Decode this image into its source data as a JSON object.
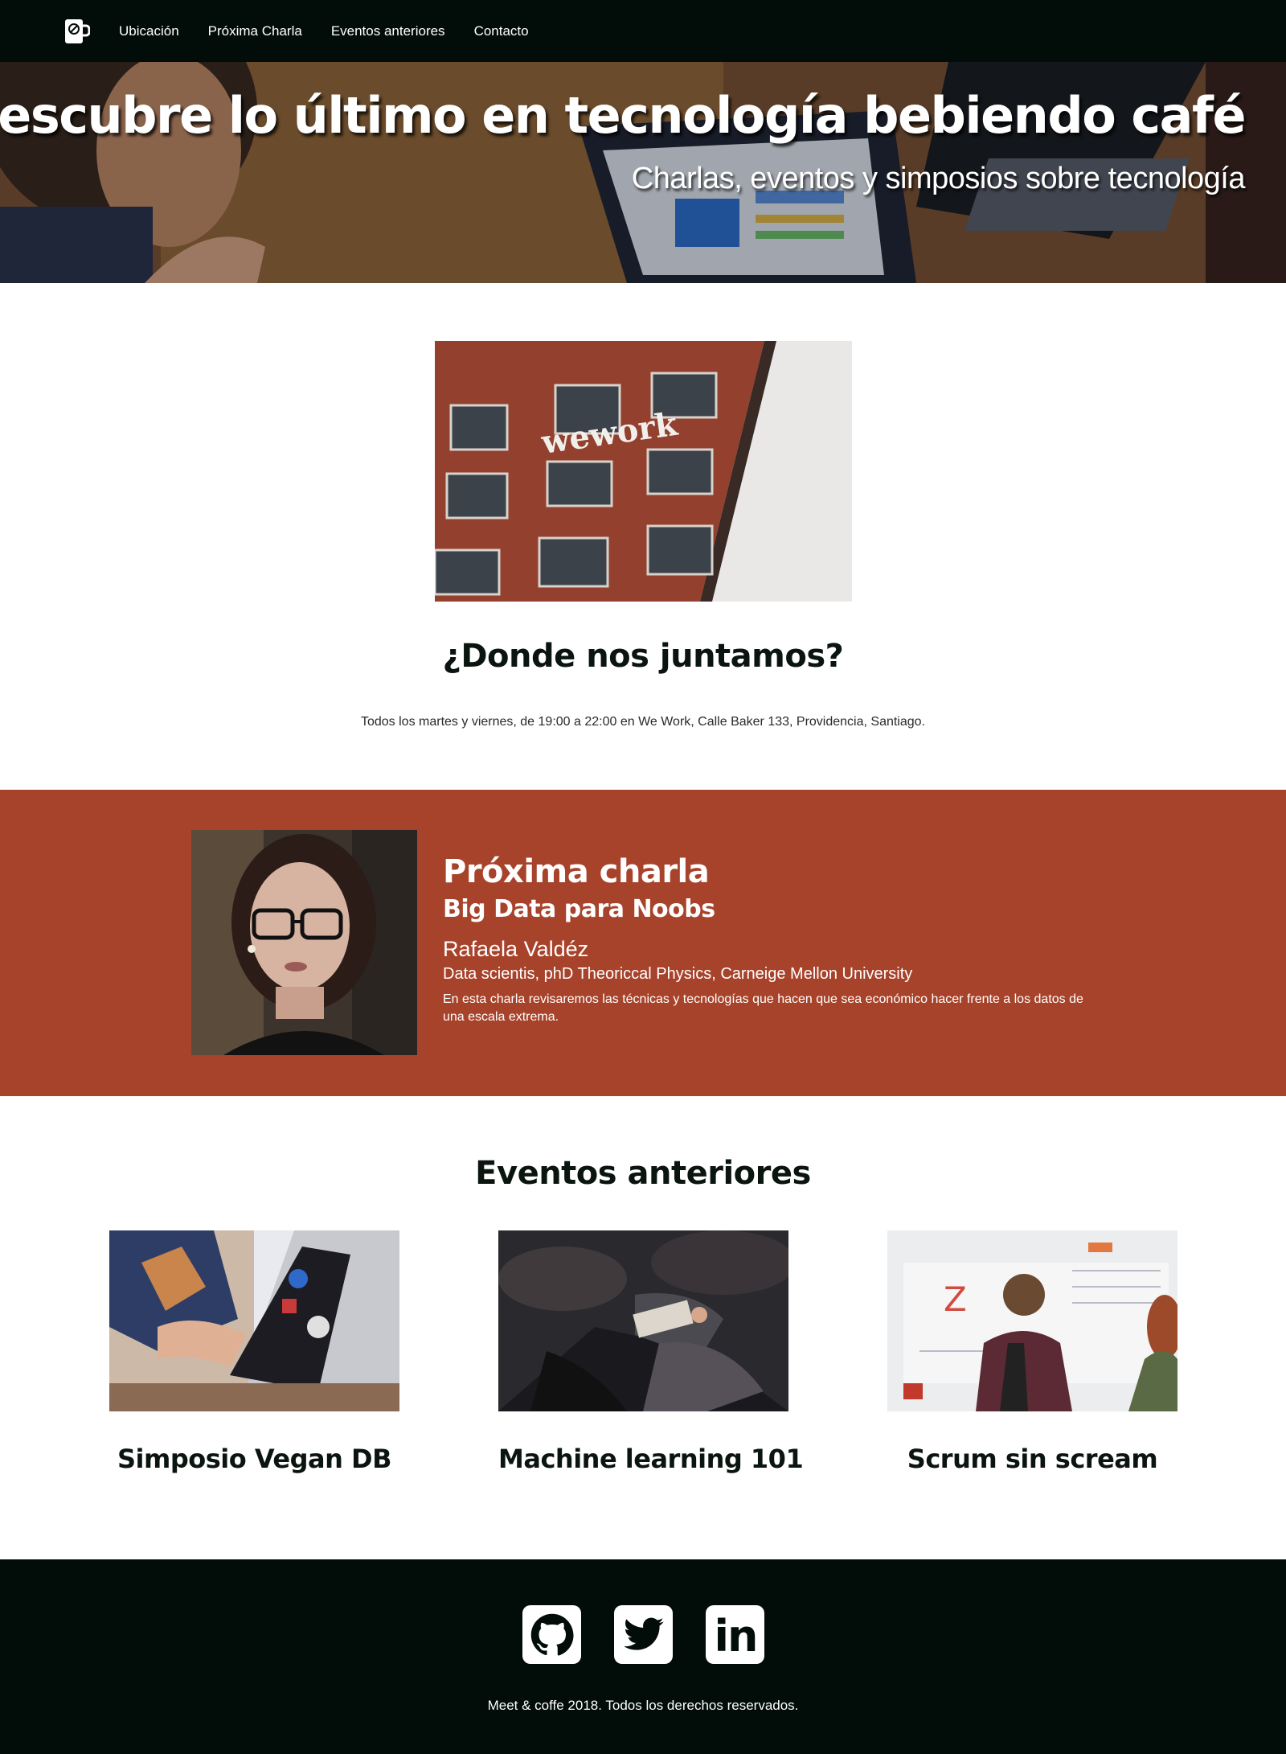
{
  "nav": {
    "items": [
      {
        "label": "Ubicación"
      },
      {
        "label": "Próxima Charla"
      },
      {
        "label": "Eventos anteriores"
      },
      {
        "label": "Contacto"
      }
    ]
  },
  "hero": {
    "title": "Descubre lo último en tecnología bebiendo café",
    "subtitle": "Charlas, eventos y simposios sobre tecnología"
  },
  "location": {
    "photo_sign": "wework",
    "heading": "¿Donde nos juntamos?",
    "text": "Todos los martes y viernes, de 19:00 a 22:00 en We Work, Calle Baker 133, Providencia, Santiago."
  },
  "next_talk": {
    "heading": "Próxima charla",
    "title": "Big Data para Noobs",
    "speaker_name": "Rafaela Valdéz",
    "speaker_role": "Data scientis, phD Theoriccal Physics, Carneige Mellon University",
    "description": "En esta charla revisaremos las técnicas y tecnologías que hacen que sea económico hacer frente a los datos de una escala extrema."
  },
  "past_events": {
    "heading": "Eventos anteriores",
    "items": [
      {
        "title": "Simposio Vegan DB"
      },
      {
        "title": "Machine learning 101"
      },
      {
        "title": "Scrum sin scream"
      }
    ]
  },
  "footer": {
    "social": [
      {
        "icon": "github-icon"
      },
      {
        "icon": "twitter-icon"
      },
      {
        "icon": "linkedin-icon"
      }
    ],
    "linkedin_glyph": "in",
    "copyright": "Meet & coffe 2018. Todos los derechos reservados."
  },
  "colors": {
    "navbar_bg": "#020c08",
    "accent_section_bg": "#a8432b",
    "footer_bg": "#020c08",
    "text_dark": "#0b1510"
  }
}
